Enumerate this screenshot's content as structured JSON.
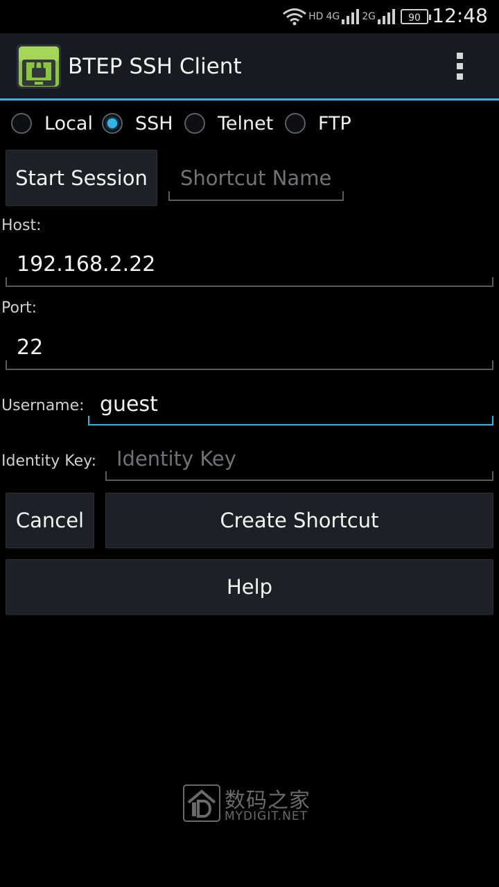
{
  "status_bar": {
    "time": "12:48",
    "network_hd": "HD",
    "network_4g": "4G",
    "network_2g": "2G",
    "battery": "90"
  },
  "action_bar": {
    "title": "BTEP SSH Client",
    "icon": "terminal-lock-icon",
    "menu_icon": "overflow-menu-icon"
  },
  "protocols": [
    {
      "label": "Local",
      "checked": false
    },
    {
      "label": "SSH",
      "checked": true
    },
    {
      "label": "Telnet",
      "checked": false
    },
    {
      "label": "FTP",
      "checked": false
    }
  ],
  "session": {
    "start_label": "Start Session",
    "shortcut_placeholder": "Shortcut Name"
  },
  "form": {
    "host_label": "Host:",
    "host_value": "192.168.2.22",
    "port_label": "Port:",
    "port_value": "22",
    "username_label": "Username:",
    "username_value": "guest",
    "identity_label": "Identity Key:",
    "identity_placeholder": "Identity Key"
  },
  "buttons": {
    "cancel": "Cancel",
    "create_shortcut": "Create Shortcut",
    "help": "Help"
  },
  "watermark": {
    "cn": "数码之家",
    "en": "MYDIGIT.NET"
  },
  "colors": {
    "accent": "#33b5e5",
    "action_bar": "#161b21",
    "button": "#1d2127"
  }
}
